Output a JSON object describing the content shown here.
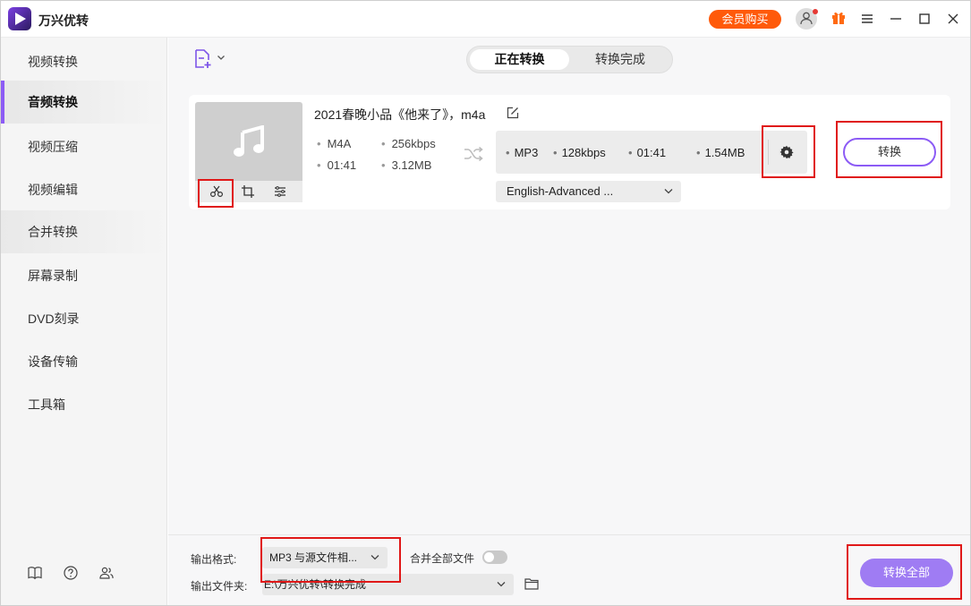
{
  "app": {
    "title": "万兴优转",
    "vip_label": "会员购买"
  },
  "sidebar": {
    "items": [
      {
        "label": "视频转换"
      },
      {
        "label": "音频转换"
      },
      {
        "label": "视频压缩"
      },
      {
        "label": "视频编辑"
      },
      {
        "label": "合并转换"
      },
      {
        "label": "屏幕录制"
      },
      {
        "label": "DVD刻录"
      },
      {
        "label": "设备传输"
      },
      {
        "label": "工具箱"
      }
    ],
    "active": "音频转换"
  },
  "tabs": {
    "converting": "正在转换",
    "done": "转换完成"
  },
  "file": {
    "name": "2021春晚小品《他来了》，m4a",
    "source": {
      "format": "M4A",
      "bitrate": "256kbps",
      "duration": "01:41",
      "size": "3.12MB"
    },
    "target": {
      "format": "MP3",
      "bitrate": "128kbps",
      "duration": "01:41",
      "size": "1.54MB"
    },
    "audio_track": "English-Advanced ...",
    "convert_label": "转换"
  },
  "bottom": {
    "output_format_label": "输出格式:",
    "output_format_value": "MP3 与源文件相...",
    "merge_label": "合并全部文件",
    "output_folder_label": "输出文件夹:",
    "output_folder_value": "E:\\万兴优转\\转换完成",
    "convert_all_label": "转换全部"
  },
  "colors": {
    "accent": "#8c5bf5",
    "vip": "#ff5a0a",
    "highlight": "#e01818"
  }
}
